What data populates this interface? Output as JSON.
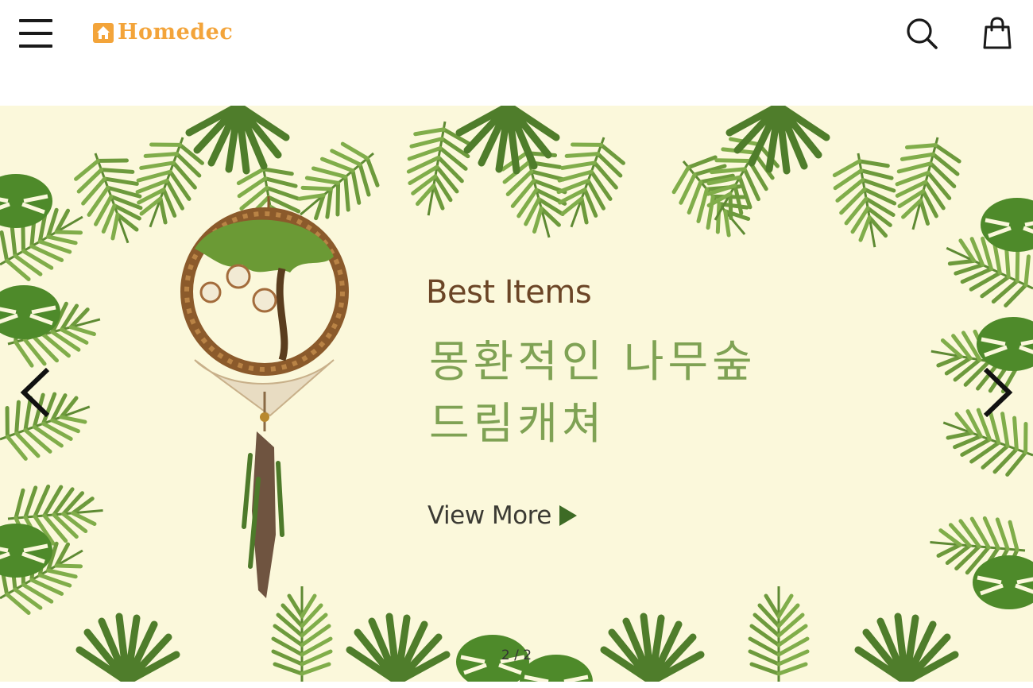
{
  "header": {
    "logo_text": "Homedec",
    "menu_icon": "hamburger-menu-icon",
    "search_icon": "search-icon",
    "cart_icon": "shopping-bag-icon"
  },
  "banner": {
    "subtitle": "Best Items",
    "title_line1": "몽환적인 나무숲",
    "title_line2": "드림캐쳐",
    "cta_label": "View More",
    "cta_icon": "play-triangle-icon",
    "prev_icon": "chevron-left-icon",
    "next_icon": "chevron-right-icon",
    "pager_current": "2",
    "pager_separator": "/",
    "pager_total": "2"
  },
  "colors": {
    "logo": "#f3a43a",
    "banner_background": "#fbf8db",
    "subtitle": "#6b4526",
    "title": "#7fa254",
    "cta_arrow": "#3d6b25"
  }
}
